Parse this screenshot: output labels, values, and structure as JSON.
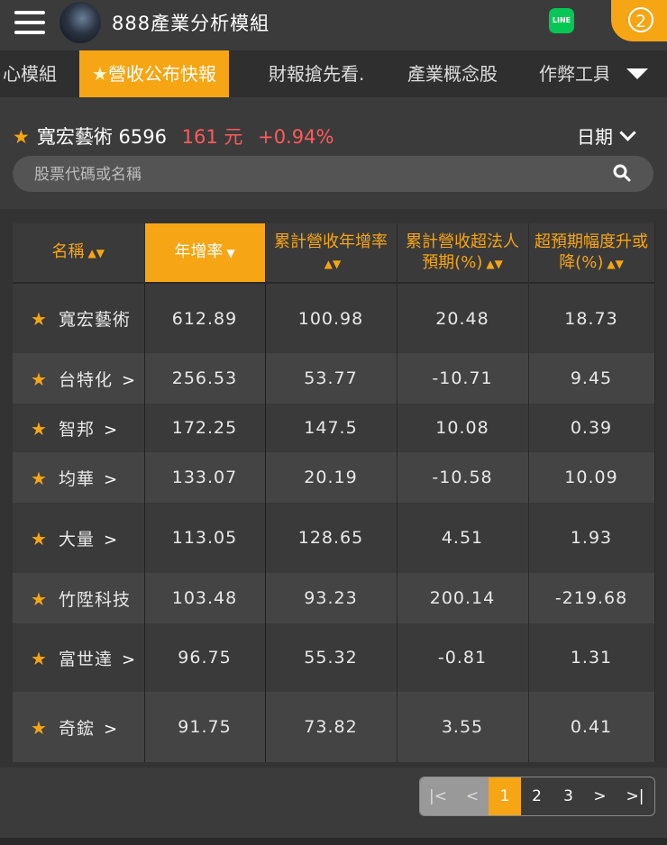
{
  "header": {
    "title": "888產業分析模組",
    "line_label": "LINE",
    "notif_count": "2"
  },
  "tabs": [
    {
      "label": "心模組"
    },
    {
      "label": "營收公布快報",
      "active": true
    },
    {
      "label": "財報搶先看."
    },
    {
      "label": "產業概念股"
    },
    {
      "label": "作弊工具"
    }
  ],
  "stock": {
    "name": "寬宏藝術",
    "code": "6596",
    "price": "161 元",
    "change": "+0.94%"
  },
  "date_label": "日期",
  "search": {
    "placeholder": "股票代碼或名稱"
  },
  "table": {
    "headers": [
      "名稱",
      "年增率",
      "累計營收年增率",
      "累計營收超法人預期(%)",
      "超預期幅度升或降(%)"
    ],
    "rows": [
      {
        "name": "寬宏藝術",
        "arrow": false,
        "v": [
          "612.89",
          "100.98",
          "20.48",
          "18.73"
        ]
      },
      {
        "name": "台特化",
        "arrow": true,
        "v": [
          "256.53",
          "53.77",
          "-10.71",
          "9.45"
        ]
      },
      {
        "name": "智邦",
        "arrow": true,
        "v": [
          "172.25",
          "147.5",
          "10.08",
          "0.39"
        ]
      },
      {
        "name": "均華",
        "arrow": true,
        "v": [
          "133.07",
          "20.19",
          "-10.58",
          "10.09"
        ]
      },
      {
        "name": "大量",
        "arrow": true,
        "v": [
          "113.05",
          "128.65",
          "4.51",
          "1.93"
        ]
      },
      {
        "name": "竹陞科技",
        "arrow": false,
        "v": [
          "103.48",
          "93.23",
          "200.14",
          "-219.68"
        ]
      },
      {
        "name": "富世達",
        "arrow": true,
        "v": [
          "96.75",
          "55.32",
          "-0.81",
          "1.31"
        ]
      },
      {
        "name": "奇鋐",
        "arrow": true,
        "v": [
          "91.75",
          "73.82",
          "3.55",
          "0.41"
        ]
      }
    ]
  },
  "pager": {
    "first": "|<",
    "prev": "<",
    "pages": [
      "1",
      "2",
      "3"
    ],
    "next": ">",
    "last": ">|"
  },
  "colors": {
    "accent": "#f6a514",
    "up": "#ff5a5a",
    "bg": "#3b3b3b"
  }
}
